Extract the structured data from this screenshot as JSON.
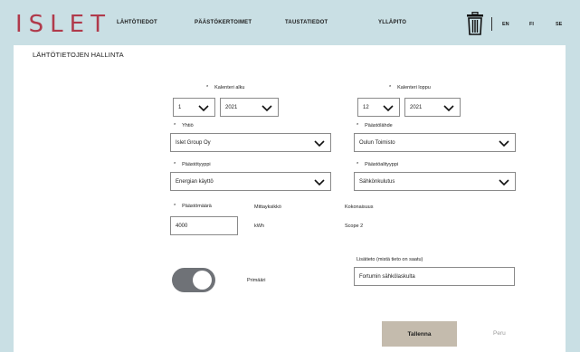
{
  "header": {
    "logo": "ISLET",
    "nav": [
      "LÄHTÖTIEDOT",
      "PÄÄSTÖKERTOIMET",
      "TAUSTATIEDOT",
      "YLLÄPITO"
    ],
    "languages": [
      "EN",
      "FI",
      "SE"
    ]
  },
  "page": {
    "title": "LÄHTÖTIETOJEN HALLINTA"
  },
  "form": {
    "required_mark": "*",
    "calendar_start": {
      "label": "Kalenteri alku",
      "month": "1",
      "year": "2021"
    },
    "calendar_end": {
      "label": "Kalenteri loppu",
      "month": "12",
      "year": "2021"
    },
    "company": {
      "label": "Yhtiö",
      "value": "Islet Group Oy"
    },
    "emission_source": {
      "label": "Päästölähde",
      "value": "Oulun Toimisto"
    },
    "emission_type": {
      "label": "Päästötyyppi",
      "value": "Energian käyttö"
    },
    "emission_subtype": {
      "label": "Päästöalityyppi",
      "value": "Sähkönkulutus"
    },
    "emission_amount": {
      "label": "Päästömäärä",
      "value": "4000"
    },
    "unit": {
      "label": "Mittayksikkö",
      "value": "kWh"
    },
    "scope": {
      "label": "Kokonaisuus",
      "value": "Scope 2"
    },
    "primary_toggle": {
      "label": "Primääri",
      "on": true
    },
    "additional_info": {
      "label": "Lisätieto (mistä tieto on saatu)",
      "value": "Fortumin sähkölaskulta"
    }
  },
  "actions": {
    "save_label": "Tallenna",
    "cancel_label": "Peru"
  },
  "colors": {
    "brand": "#b03a4b",
    "background": "#c9dfe4",
    "save_button": "#c4bbad",
    "toggle": "#6f7277"
  }
}
